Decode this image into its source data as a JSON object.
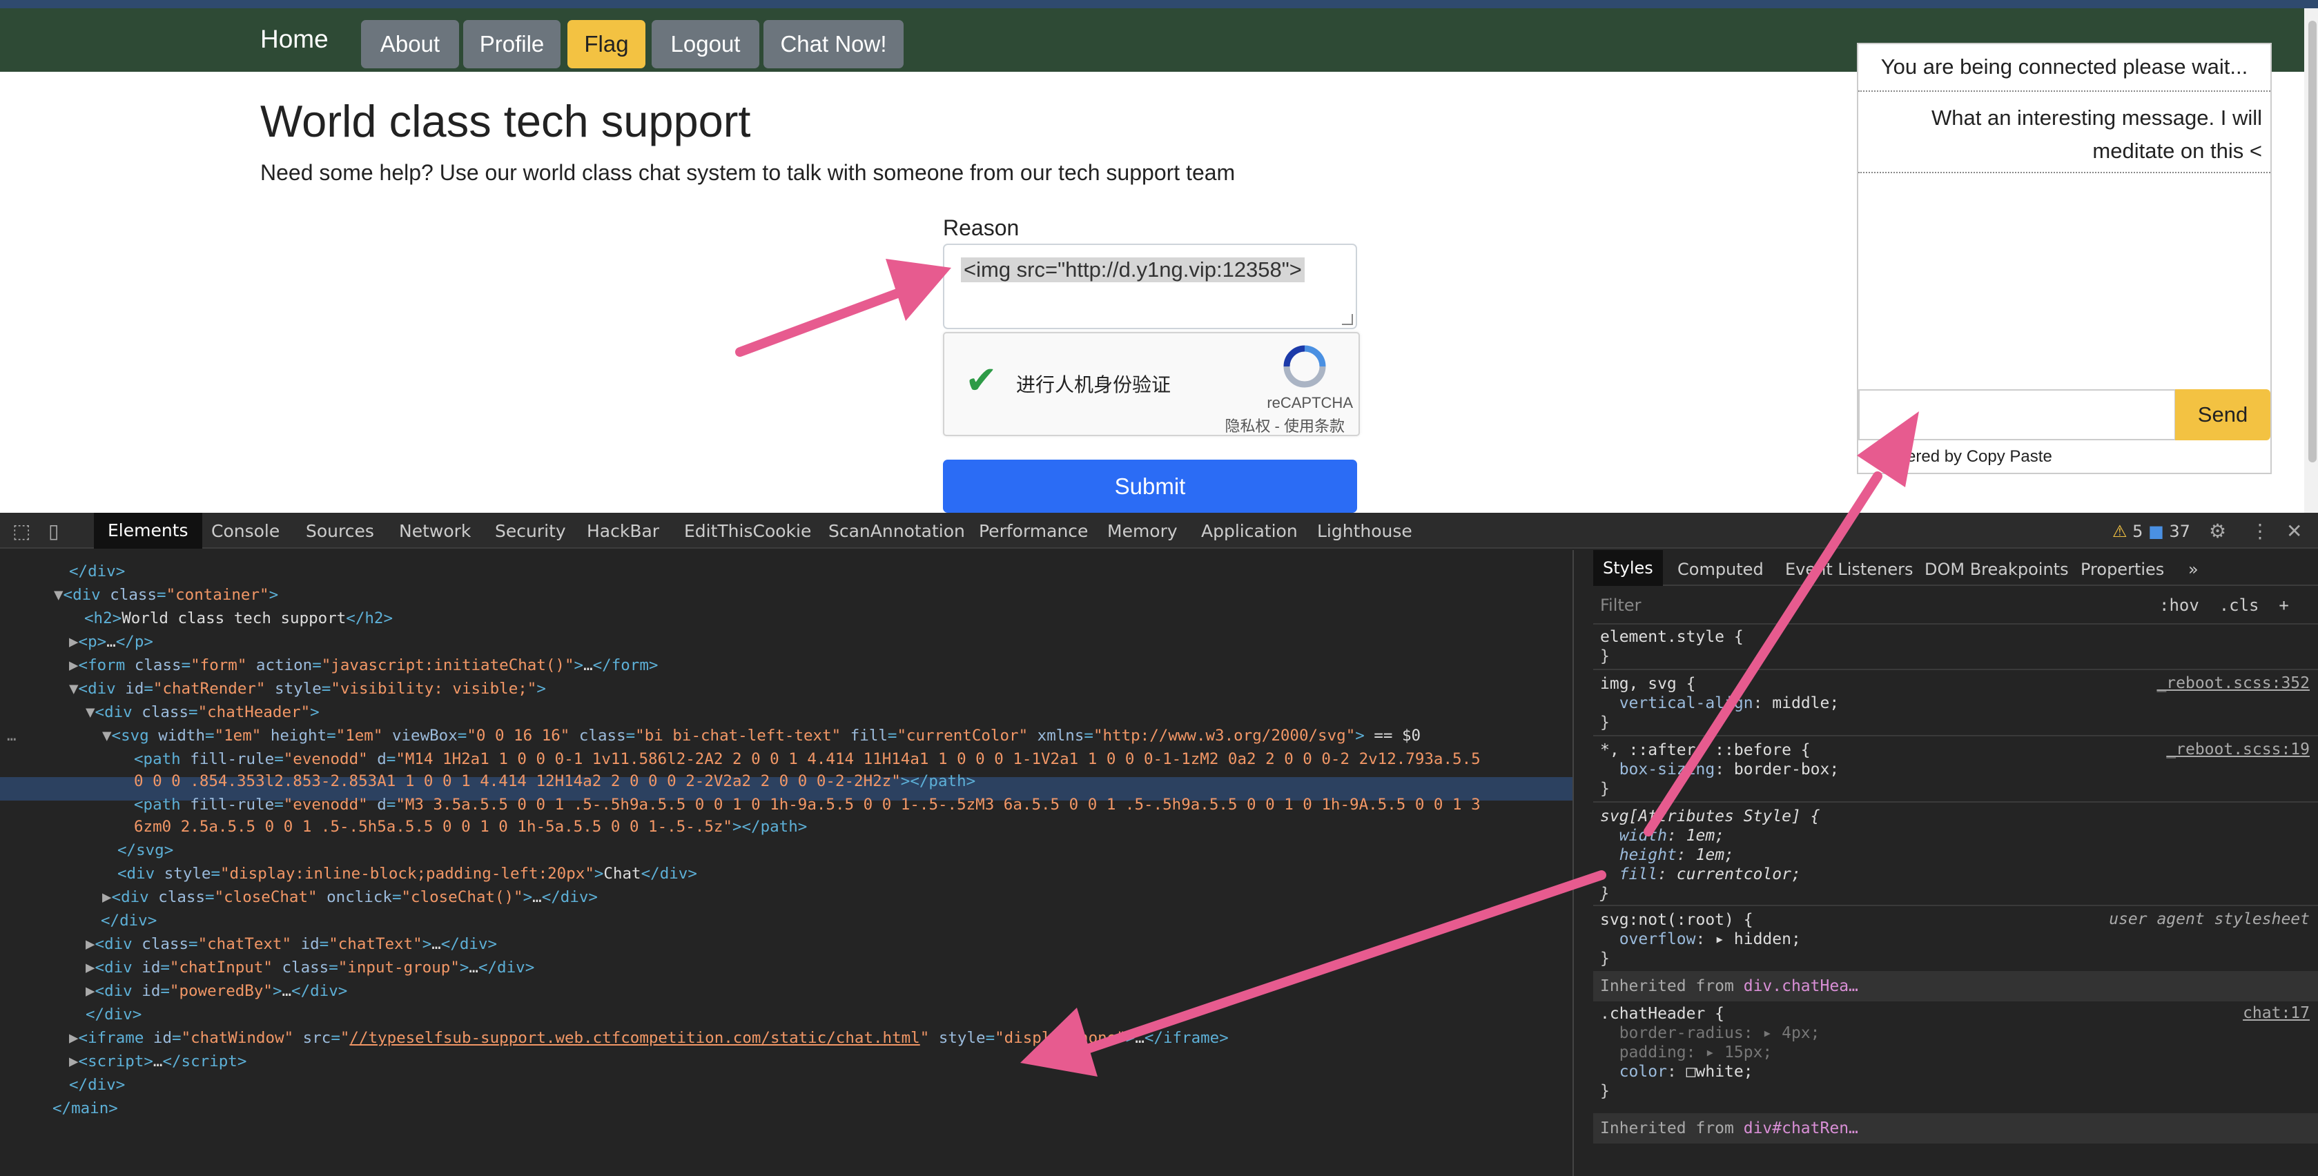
{
  "nav": {
    "home": "Home",
    "buttons": [
      "About",
      "Profile",
      "Flag",
      "Logout",
      "Chat Now!"
    ]
  },
  "main": {
    "title": "World class tech support",
    "lead": "Need some help? Use our world class chat system to talk with someone from our tech support team",
    "reason_label": "Reason",
    "reason_value": "<img src=\"http://d.y1ng.vip:12358\">",
    "captcha_label": "进行人机身份验证",
    "captcha_brand": "reCAPTCHA",
    "captcha_links": "隐私权 - 使用条款",
    "submit": "Submit"
  },
  "chat": {
    "msg1": "You are being connected please wait...",
    "msg2": "What an interesting message. I will meditate on this <",
    "send": "Send",
    "powered": "ered by Copy Paste"
  },
  "devtools": {
    "tabs": [
      "Elements",
      "Console",
      "Sources",
      "Network",
      "Security",
      "HackBar",
      "EditThisCookie",
      "ScanAnnotation",
      "Performance",
      "Memory",
      "Application",
      "Lighthouse"
    ],
    "warnings": "5",
    "messages": "37",
    "styles_tabs": [
      "Styles",
      "Computed",
      "Event Listeners",
      "DOM Breakpoints",
      "Properties",
      "»"
    ],
    "filter_placeholder": "Filter",
    "hov": ":hov",
    "cls": ".cls"
  },
  "colors": {
    "navbar": "#2e4a35",
    "flag_button": "#f3c242",
    "submit_button": "#2b6cf5",
    "arrow": "#e75b8f"
  }
}
